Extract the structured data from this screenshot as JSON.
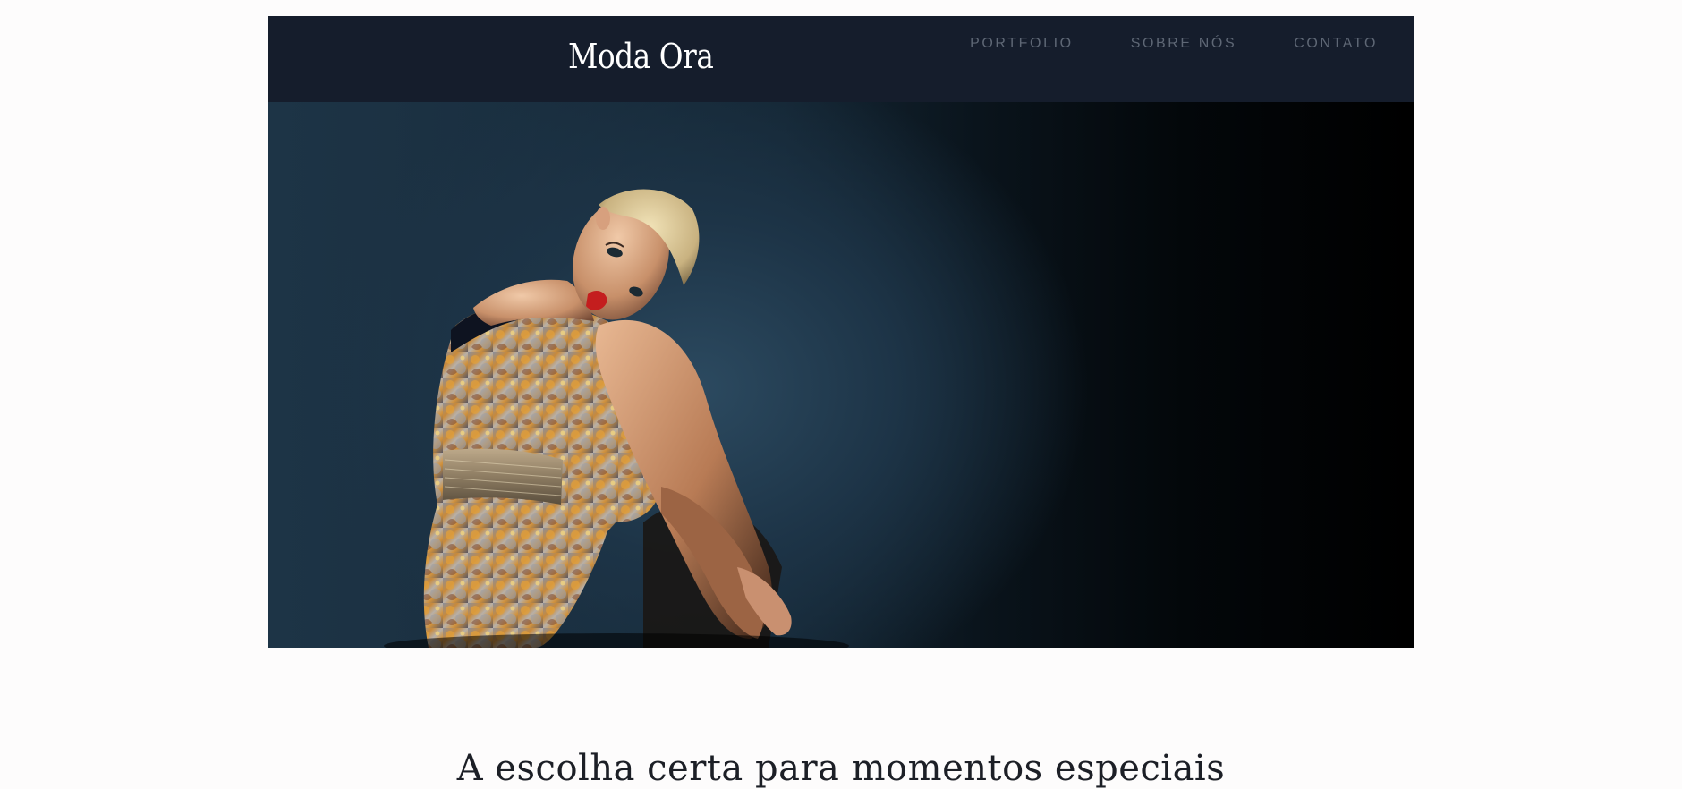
{
  "header": {
    "logo": "Moda Ora",
    "nav": [
      {
        "label": "PORTFOLIO"
      },
      {
        "label": "SOBRE NÓS"
      },
      {
        "label": "CONTATO"
      }
    ]
  },
  "main": {
    "tagline": "A escolha certa para momentos especiais"
  },
  "colors": {
    "header_bg": "#151d2c",
    "nav_text": "#5e6775",
    "logo_text": "#ffffff",
    "page_bg": "#fdfcfc"
  }
}
